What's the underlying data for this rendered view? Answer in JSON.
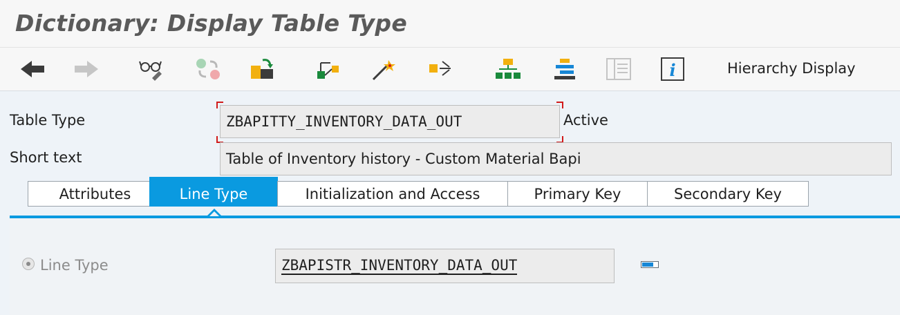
{
  "window": {
    "title": "Dictionary: Display Table Type"
  },
  "toolbar": {
    "items": [
      {
        "name": "back-icon"
      },
      {
        "name": "forward-icon"
      },
      {
        "name": "display-change-icon"
      },
      {
        "name": "other-object-icon"
      },
      {
        "name": "check-icon"
      },
      {
        "name": "activate-icon"
      },
      {
        "name": "where-used-icon"
      },
      {
        "name": "object-list-icon"
      },
      {
        "name": "hierarchy-icon"
      },
      {
        "name": "documentation-icon"
      },
      {
        "name": "table-display-icon"
      },
      {
        "name": "info-icon"
      }
    ],
    "hierarchy_label": "Hierarchy Display"
  },
  "form": {
    "table_type_label": "Table Type",
    "table_type_value": "ZBAPITTY_INVENTORY_DATA_OUT",
    "status": "Active",
    "short_text_label": "Short text",
    "short_text_value": "Table of Inventory history - Custom Material Bapi"
  },
  "tabs": [
    {
      "label": "Attributes",
      "active": false
    },
    {
      "label": "Line Type",
      "active": true
    },
    {
      "label": "Initialization and Access",
      "active": false
    },
    {
      "label": "Primary Key",
      "active": false
    },
    {
      "label": "Secondary Key",
      "active": false
    }
  ],
  "line_type_panel": {
    "radio_label": "Line Type",
    "value": "ZBAPISTR_INVENTORY_DATA_OUT"
  },
  "colors": {
    "accent": "#0a9ae0",
    "required_marker": "#d11a1a"
  }
}
